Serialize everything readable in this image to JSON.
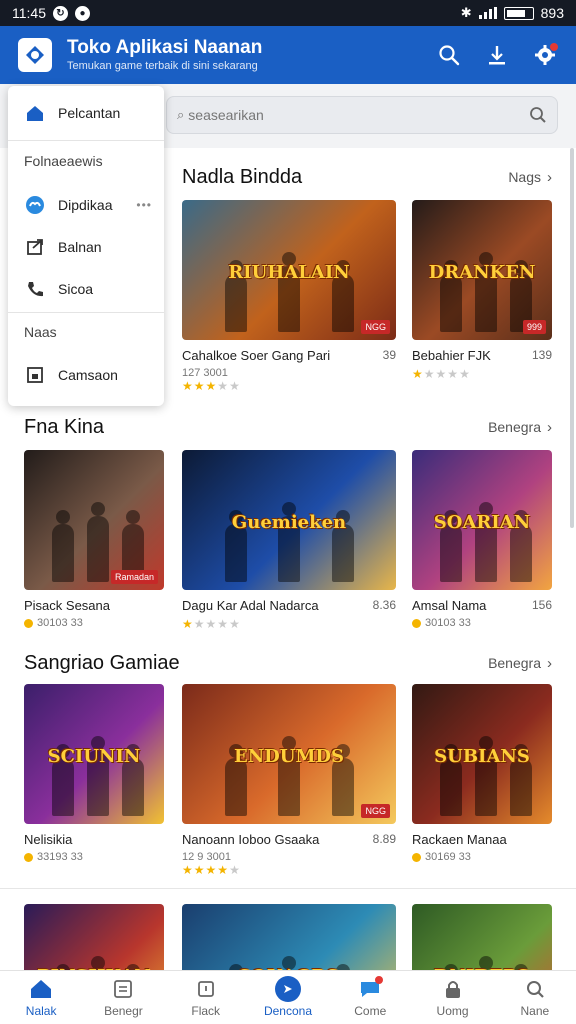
{
  "status_bar": {
    "time": "11:45",
    "battery": "893"
  },
  "app_bar": {
    "title": "Toko Aplikasi Naanan",
    "subtitle": "Temukan game terbaik di sini sekarang"
  },
  "search": {
    "text": "seasearikan"
  },
  "dropdown": {
    "items": [
      {
        "label": "Pelcantan",
        "icon": "home-icon"
      },
      {
        "label": "Dipdikaa",
        "icon": "cloud-icon"
      },
      {
        "label": "Balnan",
        "icon": "share-icon"
      },
      {
        "label": "Sicoa",
        "icon": "phone-icon"
      },
      {
        "label": "Camsaon",
        "icon": "image-icon"
      }
    ],
    "sections": [
      "Folnaeaewis",
      "Naas"
    ],
    "more_glyph": "•••"
  },
  "sections": [
    {
      "title": "Nadla Bindda",
      "more": "Nags",
      "cards": [
        {
          "name": "Cahalkoe Soer Gang Pari",
          "num": "39",
          "meta": "127 3001",
          "rating": 3,
          "badge": "NGG",
          "art": "RIUHALAIN",
          "colors": [
            "#3a6a88",
            "#c1621c",
            "#7b2b17"
          ]
        },
        {
          "name": "Bebahier FJK",
          "num": "139",
          "meta": "",
          "rating": 1,
          "badge": "999",
          "art": "DRANKEN",
          "colors": [
            "#241b19",
            "#9b4a24",
            "#5a2e1a"
          ]
        }
      ]
    },
    {
      "title": "Fna Kina",
      "more": "Benegra",
      "cards": [
        {
          "name": "Pisack Sesana",
          "num": "",
          "meta": "30103 33",
          "rating": 0,
          "badge": "Ramadan",
          "art": "",
          "colors": [
            "#221c1a",
            "#7a5a48",
            "#c0392b"
          ]
        },
        {
          "name": "Dagu Kar Adal Nadarca",
          "num": "8.36",
          "meta": "",
          "rating": 1,
          "badge": "",
          "art": "Guemieken",
          "colors": [
            "#0c1a35",
            "#1e4da8",
            "#e8b64a"
          ]
        },
        {
          "name": "Amsal Nama",
          "num": "156",
          "meta": "30103 33",
          "rating": 0,
          "badge": "",
          "art": "SOARIAN",
          "colors": [
            "#3a2c7a",
            "#b04280",
            "#f2a540"
          ]
        }
      ]
    },
    {
      "title": "Sangriao Gamiae",
      "more": "Benegra",
      "cards": [
        {
          "name": "Nelisikia",
          "num": "",
          "meta": "33193 33",
          "rating": 0,
          "badge": "",
          "art": "SCIUNIN",
          "colors": [
            "#3b1f6a",
            "#8a2f9c",
            "#f1c232"
          ]
        },
        {
          "name": "Nanoann Ioboo Gsaaka",
          "num": "8.89",
          "meta": "12 9 3001",
          "rating": 4,
          "badge": "NGG",
          "art": "ENDUMDS",
          "colors": [
            "#7b2a1a",
            "#d96a2b",
            "#f4c95d"
          ]
        },
        {
          "name": "Rackaen Manaa",
          "num": "",
          "meta": "30169 33",
          "rating": 0,
          "badge": "",
          "art": "SUBIANS",
          "colors": [
            "#321913",
            "#8b2b1f",
            "#e58b2c"
          ]
        }
      ]
    },
    {
      "title": "",
      "more": "",
      "cards": [
        {
          "name": "",
          "num": "",
          "meta": "",
          "rating": 0,
          "badge": "",
          "art": "PINSHKAN",
          "colors": [
            "#2a1b58",
            "#b8362d",
            "#f2b233"
          ]
        },
        {
          "name": "",
          "num": "",
          "meta": "",
          "rating": 0,
          "badge": "",
          "art": "SOUAGRS",
          "colors": [
            "#1a3e6e",
            "#2d8bb5",
            "#f1c84a"
          ]
        },
        {
          "name": "",
          "num": "",
          "meta": "",
          "rating": 0,
          "badge": "",
          "art": "DNIBEPS",
          "colors": [
            "#2e5a24",
            "#6a9c3a",
            "#e64a2e"
          ]
        }
      ]
    }
  ],
  "bottom_nav": [
    {
      "label": "Nalak",
      "icon": "home-icon",
      "active": true
    },
    {
      "label": "Benegr",
      "icon": "grid-icon",
      "active": false
    },
    {
      "label": "Flack",
      "icon": "box-icon",
      "active": false
    },
    {
      "label": "Dencona",
      "icon": "compass-icon",
      "active": false
    },
    {
      "label": "Come",
      "icon": "chat-icon",
      "active": false
    },
    {
      "label": "Uomg",
      "icon": "lock-icon",
      "active": false
    },
    {
      "label": "Nane",
      "icon": "search-icon",
      "active": false
    }
  ]
}
